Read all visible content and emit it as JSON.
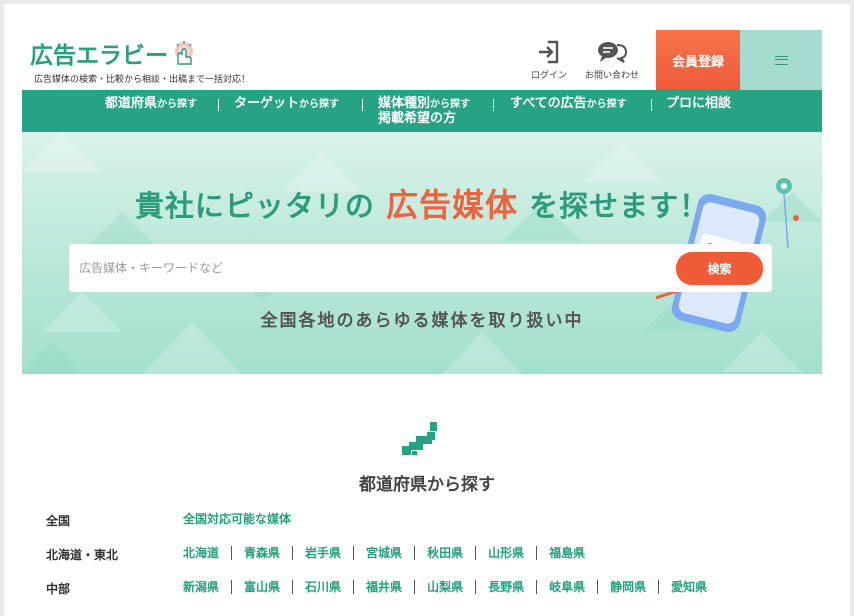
{
  "header": {
    "logo_text": "広告エラビー",
    "tagline": "広告媒体の検索・比較から相談・出稿まで一括対応！",
    "login_label": "ログイン",
    "contact_label": "お問い合わせ",
    "register_label": "会員登録"
  },
  "nav": {
    "items": [
      {
        "main": "都道府県",
        "small": "から探す"
      },
      {
        "main": "ターゲット",
        "small": "から探す"
      },
      {
        "main": "媒体種別",
        "small": "から探す"
      },
      {
        "main": "すべての広告",
        "small": "から探す"
      },
      {
        "main": "プロに相談",
        "small": ""
      }
    ],
    "extra_line": "掲載希望の方"
  },
  "hero": {
    "title_before": "貴社にピッタリの",
    "title_accent": "広告媒体",
    "title_after": "を探せます！",
    "search_placeholder": "広告媒体・キーワードなど",
    "search_button": "検索",
    "subtitle": "全国各地のあらゆる媒体を取り扱い中"
  },
  "prefecture_section": {
    "heading": "都道府県から探す",
    "regions": [
      {
        "label": "全国",
        "prefectures": [
          "全国対応可能な媒体"
        ]
      },
      {
        "label": "北海道・東北",
        "prefectures": [
          "北海道",
          "青森県",
          "岩手県",
          "宮城県",
          "秋田県",
          "山形県",
          "福島県"
        ]
      },
      {
        "label": "中部",
        "prefectures": [
          "新潟県",
          "富山県",
          "石川県",
          "福井県",
          "山梨県",
          "長野県",
          "岐阜県",
          "静岡県",
          "愛知県"
        ]
      }
    ]
  },
  "colors": {
    "brand_green": "#26a382",
    "accent_orange": "#ef5a37",
    "menu_mint": "#a6dccf"
  }
}
